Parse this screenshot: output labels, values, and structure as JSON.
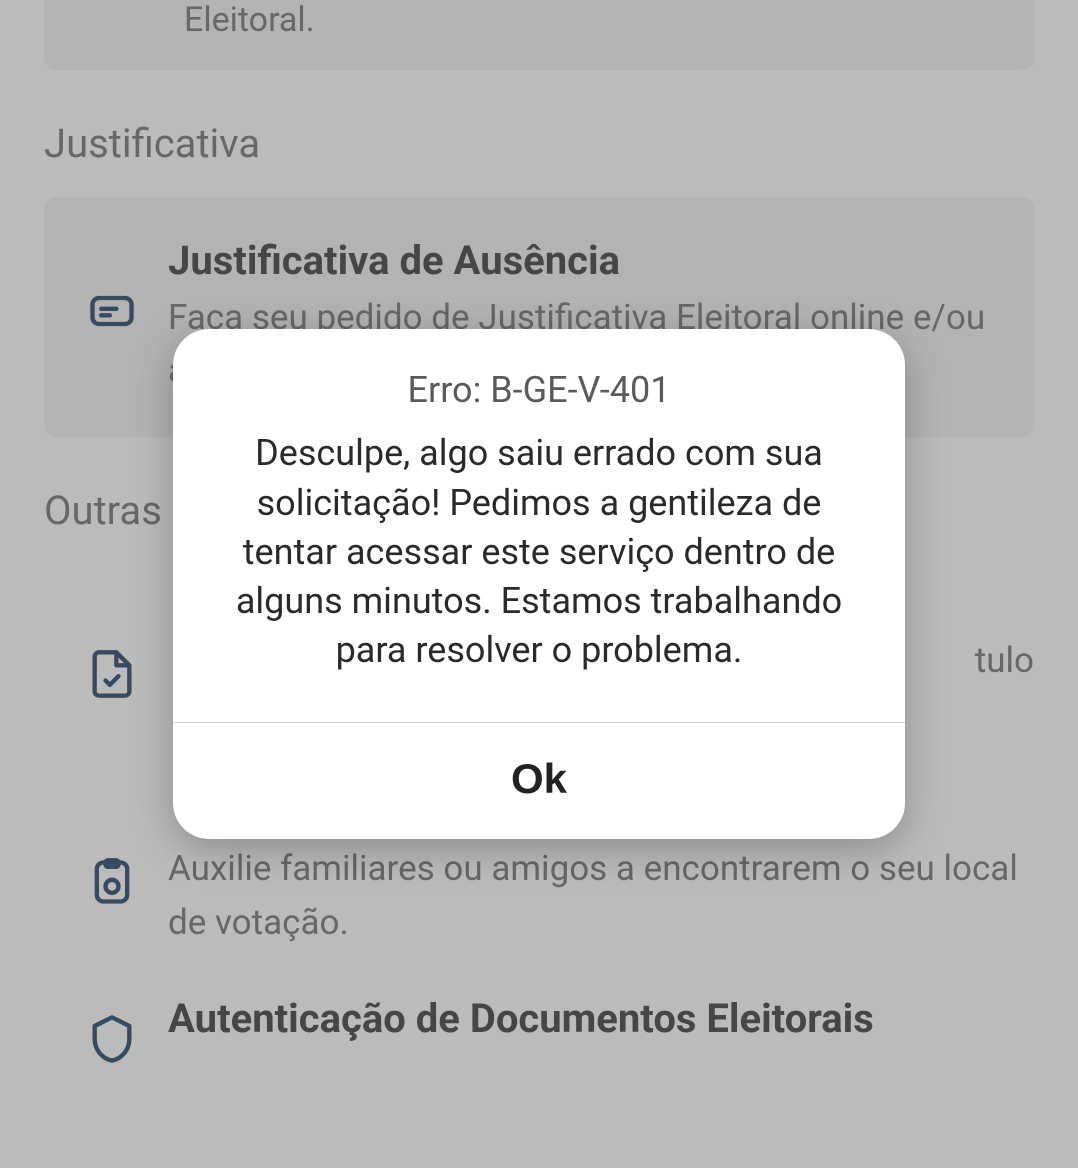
{
  "partial_top_text": "Eleitoral.",
  "sections": {
    "justif": {
      "header": "Justificativa",
      "card": {
        "title": "Justificativa de Ausência",
        "desc": "Faça seu pedido de Justificativa Eleitoral online e/ou acompanhe solicitações"
      }
    },
    "outras": {
      "header": "Outras",
      "items": {
        "debitos": {
          "desc_fragment_right": "tulo"
        },
        "locais": {
          "desc": "Auxilie familiares ou amigos a encontrarem o seu local de votação."
        },
        "autentica": {
          "title": "Autenticação de Documentos Eleitorais"
        }
      }
    }
  },
  "dialog": {
    "title": "Erro: B-GE-V-401",
    "message": "Desculpe, algo saiu errado com sua solicitação! Pedimos a gentileza de tentar acessar este serviço dentro de alguns minutos. Estamos trabalhando para resolver o problema.",
    "ok": "Ok"
  }
}
